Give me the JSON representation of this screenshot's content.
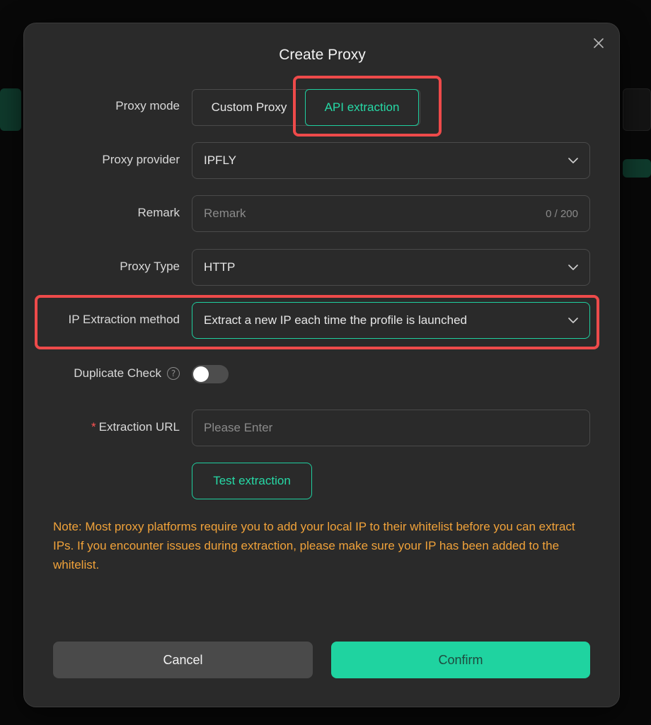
{
  "modal": {
    "title": "Create Proxy",
    "close_icon": "close-icon"
  },
  "proxy_mode": {
    "label": "Proxy mode",
    "options": [
      "Custom Proxy",
      "API extraction"
    ],
    "selected": "API extraction"
  },
  "proxy_provider": {
    "label": "Proxy provider",
    "value": "IPFLY"
  },
  "remark": {
    "label": "Remark",
    "placeholder": "Remark",
    "value": "",
    "counter": "0 / 200"
  },
  "proxy_type": {
    "label": "Proxy Type",
    "value": "HTTP"
  },
  "ip_extraction": {
    "label": "IP Extraction method",
    "value": "Extract a new IP each time the profile is launched"
  },
  "duplicate_check": {
    "label": "Duplicate Check",
    "help_icon": "question-circle-icon",
    "enabled": false
  },
  "extraction_url": {
    "required_mark": "*",
    "label": "Extraction URL",
    "placeholder": "Please Enter",
    "value": ""
  },
  "test_button": "Test extraction",
  "note": "Note: Most proxy platforms require you to add your local IP to their whitelist before you can extract IPs. If you encounter issues during extraction, please make sure your IP has been added to the whitelist.",
  "footer": {
    "cancel_label": "Cancel",
    "confirm_label": "Confirm"
  },
  "colors": {
    "accent": "#1fd3a0",
    "highlight": "#ee4a4a",
    "note": "#f0a23a",
    "modal_bg": "#2a2a2a"
  }
}
